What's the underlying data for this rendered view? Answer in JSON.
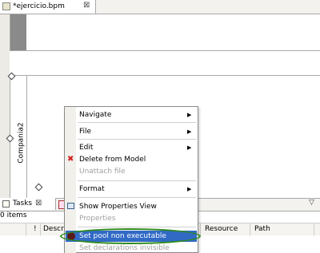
{
  "editor": {
    "tab_title": "*ejercicio.bpm",
    "close_glyph": "⊠"
  },
  "canvas": {
    "pool_label": "Compania2"
  },
  "menu": {
    "navigate": "Navigate",
    "file": "File",
    "edit": "Edit",
    "delete_from_model": "Delete from Model",
    "unattach_file": "Unattach file",
    "format": "Format",
    "show_properties_view": "Show Properties View",
    "properties": "Properties",
    "set_pool_non_executable": "Set pool non executable",
    "set_declarations_invisible": "Set declarations invisible",
    "arrow": "▶"
  },
  "tasks": {
    "tab_label": "Tasks",
    "close_glyph": "⊠",
    "items_count": "0 items",
    "columns": [
      "!",
      "Descrip",
      "Resource",
      "Path"
    ],
    "menu_chevron": "▽"
  },
  "colors": {
    "highlight": "#316ac5",
    "ellipse": "#2c8a1c",
    "delete_red": "#d42020"
  }
}
